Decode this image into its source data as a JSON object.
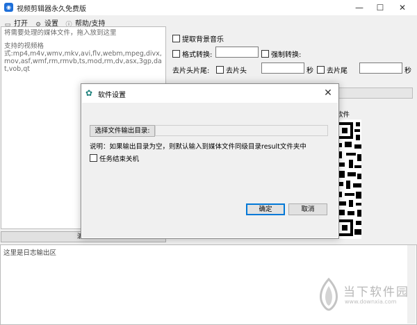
{
  "window": {
    "title": "视频剪辑器永久免费版",
    "app_icon": "chat-bubble-icon",
    "controls": [
      "minimize-icon",
      "maximize-icon",
      "close-icon"
    ]
  },
  "menu": {
    "items": [
      {
        "label": "打开",
        "icon": "open-icon"
      },
      {
        "label": "设置",
        "icon": "settings-icon"
      },
      {
        "label": "帮助/支持",
        "icon": "info-icon"
      }
    ]
  },
  "dropzone": {
    "hint": "将需要处理的媒体文件，拖入放到这里",
    "formats_title": "支持的视频格",
    "formats": "式:mp4,m4v,wmv,mkv,avi,flv,webm,mpeg,divx,mov,asf,wmf,rm,rmvb,ts,mod,rm,dv,asx,3gp,dat,vob,qt"
  },
  "clear_button": "清空",
  "options": {
    "extract_bgm": "提取背景音乐",
    "format_convert": "格式转换:",
    "force_convert": "强制转换:",
    "trim_label": "去片头片尾:",
    "trim_head": "去片头",
    "trim_tail": "去片尾",
    "seconds_unit": "秒"
  },
  "qr_label": "软件",
  "log": {
    "placeholder": "这里是日志输出区"
  },
  "watermark": {
    "text": "当下软件园",
    "url": "www.downxia.com"
  },
  "dialog": {
    "title": "软件设置",
    "choose_output_dir": "选择文件输出目录:",
    "output_dir_value": "",
    "note": "说明：如果输出目录为空，则默认输入到媒体文件同级目录result文件夹中",
    "shutdown_label": "任务结束关机",
    "ok": "确定",
    "cancel": "取消"
  }
}
